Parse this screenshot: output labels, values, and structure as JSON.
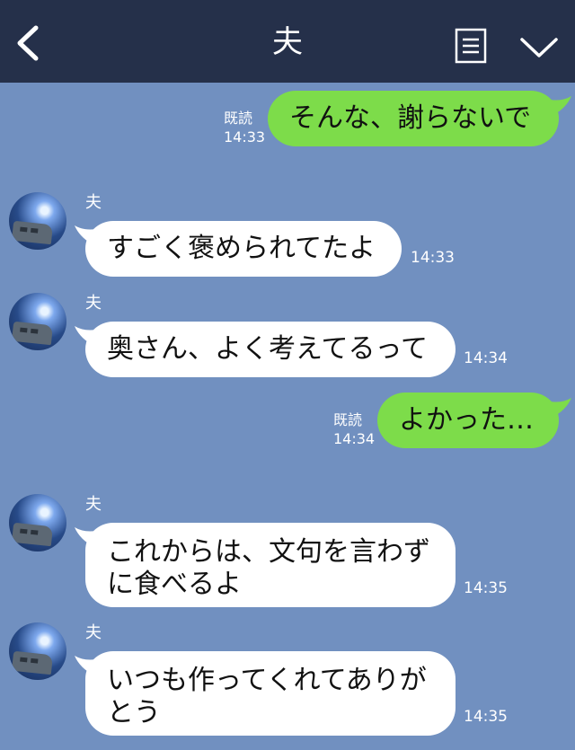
{
  "header": {
    "title": "夫",
    "back_icon": "chevron-left-icon",
    "menu_icon": "notes-icon",
    "dropdown_icon": "chevron-down-icon",
    "background": "#25304a"
  },
  "colors": {
    "chat_background": "#7190c0",
    "my_bubble": "#7ddc4a",
    "their_bubble": "#ffffff"
  },
  "messages": [
    {
      "from": "me",
      "text": "そんな、謝らないで",
      "read_label": "既読",
      "time": "14:33"
    },
    {
      "from": "them",
      "sender": "夫",
      "text": "すごく褒められてたよ",
      "time": "14:33"
    },
    {
      "from": "them",
      "sender": "夫",
      "text": "奥さん、よく考えてるって",
      "time": "14:34"
    },
    {
      "from": "me",
      "text": "よかった…",
      "read_label": "既読",
      "time": "14:34"
    },
    {
      "from": "them",
      "sender": "夫",
      "text": "これからは、文句を言わずに食べるよ",
      "time": "14:35"
    },
    {
      "from": "them",
      "sender": "夫",
      "text": "いつも作ってくれてありがとう",
      "time": "14:35"
    }
  ]
}
